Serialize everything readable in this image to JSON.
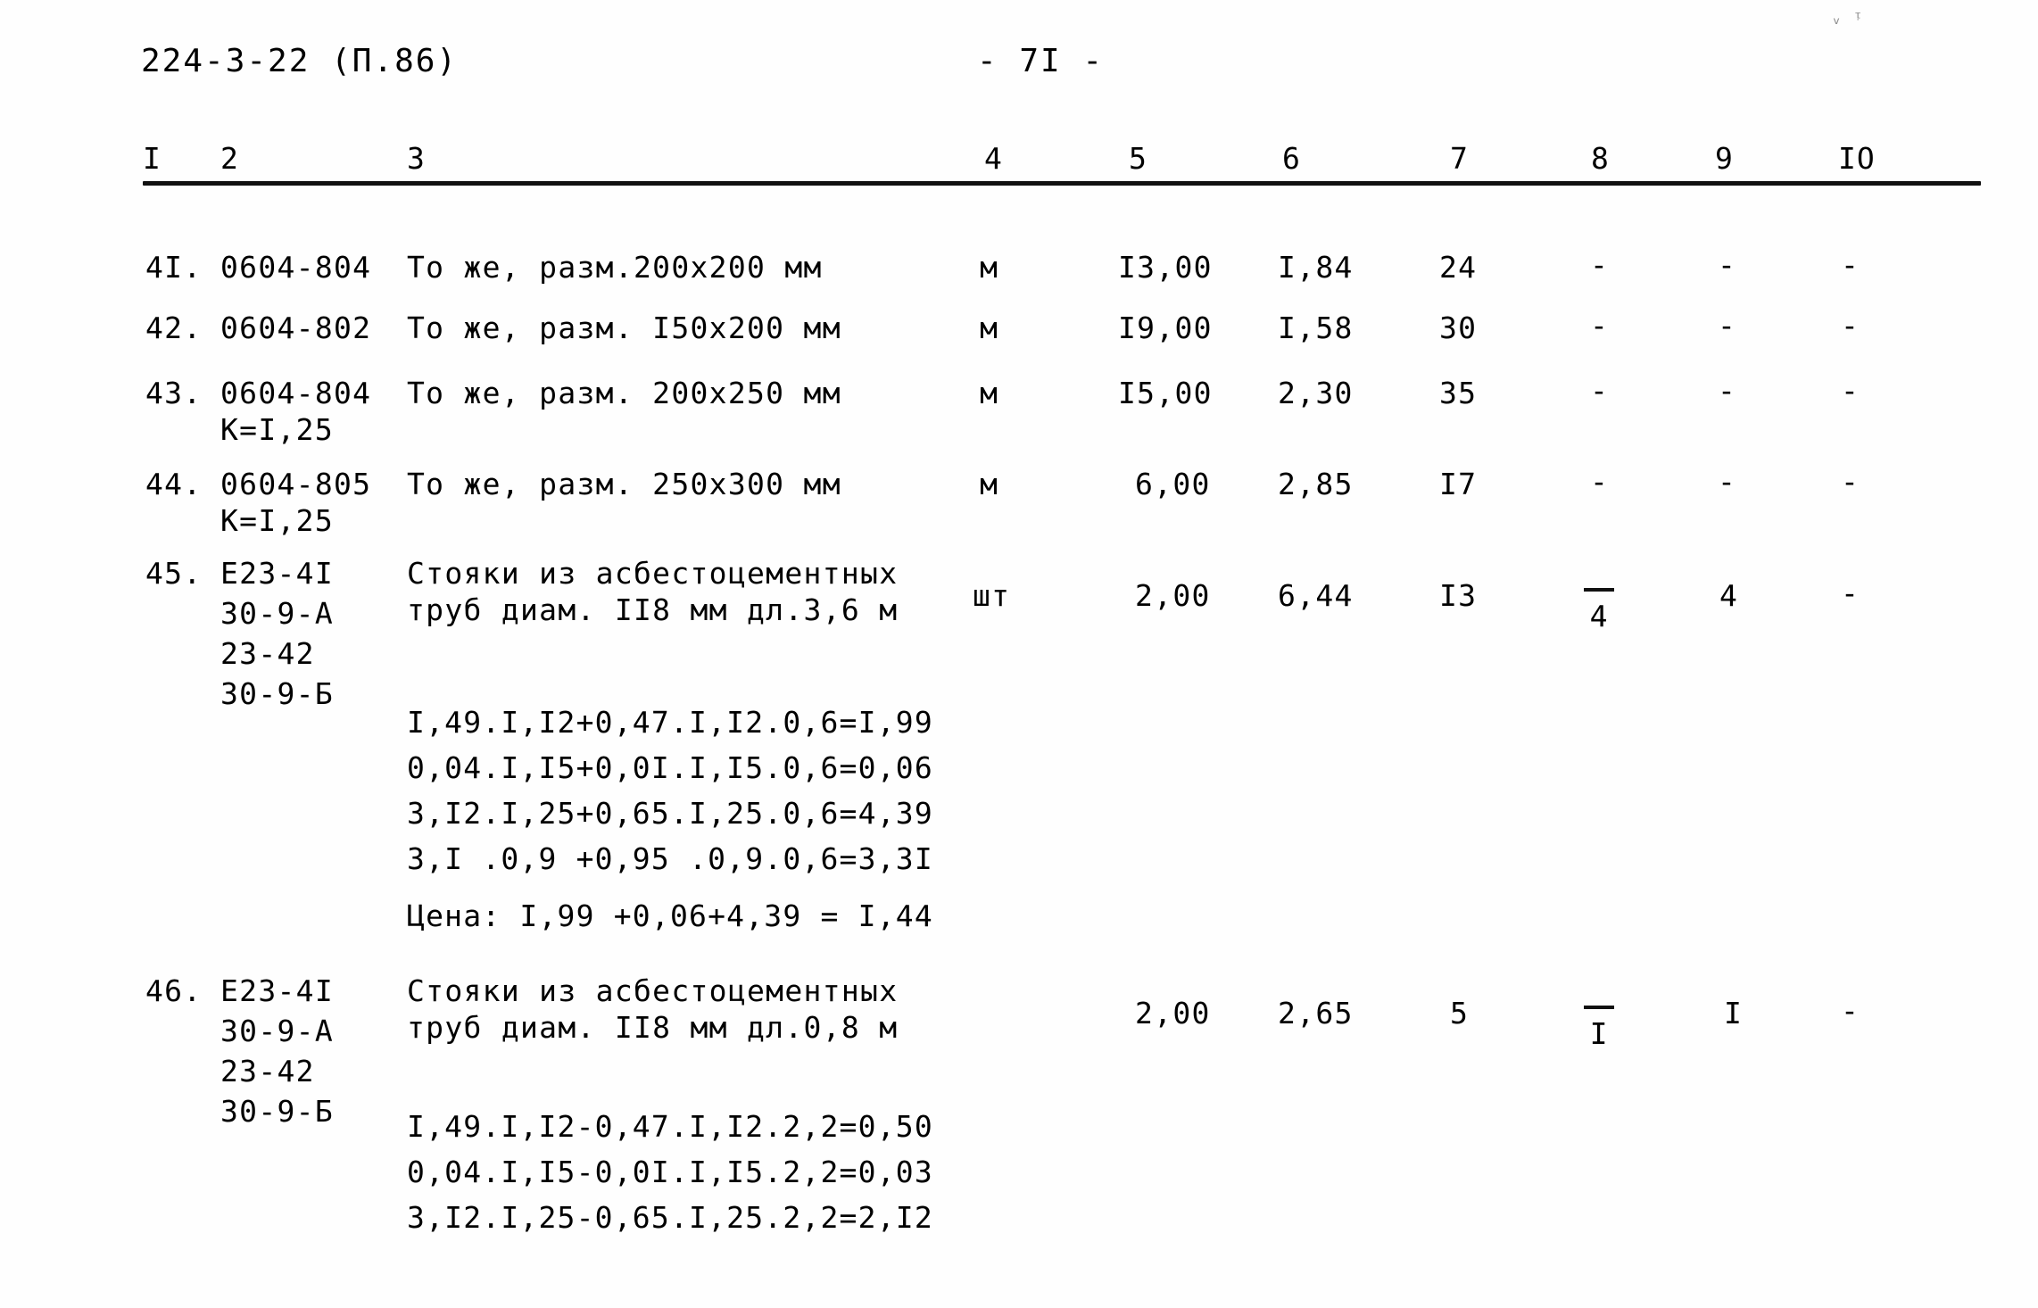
{
  "header": {
    "doc_code": "224-3-22 (П.86)",
    "page_number": "- 7I -",
    "corner_mark": "ᵥ ᵎ"
  },
  "table": {
    "column_numbers": [
      "I",
      "2",
      "3",
      "4",
      "5",
      "6",
      "7",
      "8",
      "9",
      "IO"
    ],
    "rows": [
      {
        "no": "4I.",
        "code": "0604-804",
        "desc": "То же, разм.200х200 мм",
        "unit": "м",
        "c5": "I3,00",
        "c6": "I,84",
        "c7": "24",
        "c8": "-",
        "c9": "-",
        "c10": "-"
      },
      {
        "no": "42.",
        "code": "0604-802",
        "desc": "То же, разм. I50х200 мм",
        "unit": "м",
        "c5": "I9,00",
        "c6": "I,58",
        "c7": "30",
        "c8": "-",
        "c9": "-",
        "c10": "-"
      },
      {
        "no": "43.",
        "code": "0604-804",
        "code2": "К=I,25",
        "desc": "То же, разм. 200х250 мм",
        "unit": "м",
        "c5": "I5,00",
        "c6": "2,30",
        "c7": "35",
        "c8": "-",
        "c9": "-",
        "c10": "-"
      },
      {
        "no": "44.",
        "code": "0604-805",
        "code2": "К=I,25",
        "desc": "То же, разм. 250х300 мм",
        "unit": "м",
        "c5": "6,00",
        "c6": "2,85",
        "c7": "I7",
        "c8": "-",
        "c9": "-",
        "c10": "-"
      },
      {
        "no": "45.",
        "code_block": "Е23-4I\n30-9-А\n23-42\n30-9-Б",
        "desc_line1": "Стояки из асбестоцементных",
        "desc_line2": "труб диам. II8 мм дл.3,6 м",
        "unit": "шт",
        "c5": "2,00",
        "c6": "6,44",
        "c7": "I3",
        "c8_denominator": "4",
        "c9": "4",
        "c10": "-"
      },
      {
        "no": "46.",
        "code_block": "Е23-4I\n30-9-А\n23-42\n30-9-Б",
        "desc_line1": "Стояки из асбестоцементных",
        "desc_line2": "труб диам. II8 мм дл.0,8 м",
        "unit": "",
        "c5": "2,00",
        "c6": "2,65",
        "c7": "5",
        "c8_denominator": "I",
        "c9": "I",
        "c10": "-"
      }
    ]
  },
  "calc_block_45": {
    "lines": [
      "I,49.I,I2+0,47.I,I2.0,6=I,99",
      "0,04.I,I5+0,0I.I,I5.0,6=0,06",
      "3,I2.I,25+0,65.I,25.0,6=4,39",
      "3,I .0,9 +0,95 .0,9.0,6=3,3I"
    ],
    "price_line": "Цена: I,99 +0,06+4,39 = I,44"
  },
  "calc_block_46": {
    "lines": [
      "I,49.I,I2-0,47.I,I2.2,2=0,50",
      "0,04.I,I5-0,0I.I,I5.2,2=0,03",
      "3,I2.I,25-0,65.I,25.2,2=2,I2"
    ]
  }
}
